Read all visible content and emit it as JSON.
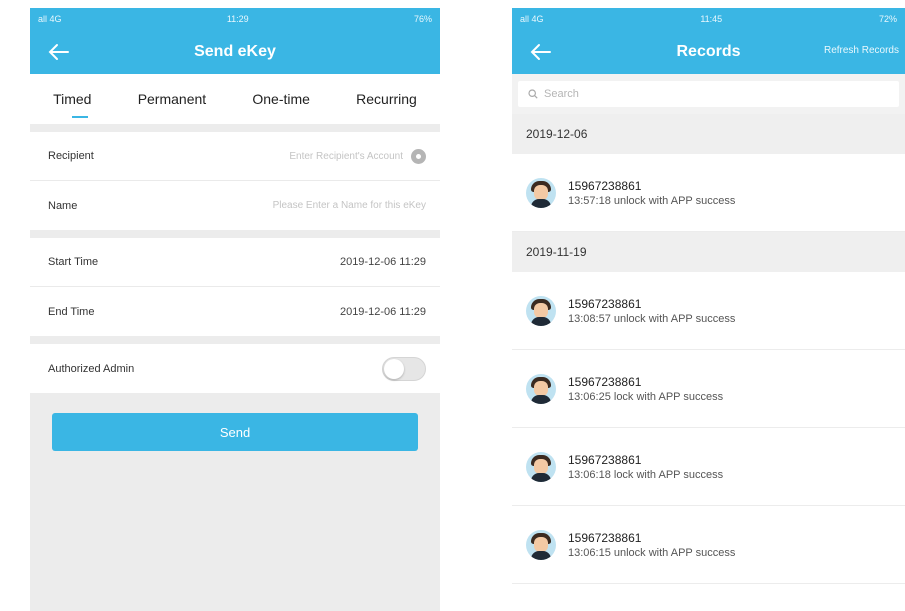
{
  "left": {
    "status": {
      "carrier": "all 4G",
      "time": "11:29",
      "battery": "76%"
    },
    "title": "Send eKey",
    "tabs": [
      "Timed",
      "Permanent",
      "One-time",
      "Recurring"
    ],
    "recipient": {
      "label": "Recipient",
      "placeholder": "Enter Recipient's Account"
    },
    "name": {
      "label": "Name",
      "placeholder": "Please Enter a Name for this eKey"
    },
    "start_time": {
      "label": "Start Time",
      "value": "2019-12-06 11:29"
    },
    "end_time": {
      "label": "End Time",
      "value": "2019-12-06 11:29"
    },
    "admin": {
      "label": "Authorized Admin"
    },
    "send_label": "Send"
  },
  "right": {
    "status": {
      "carrier": "all 4G",
      "time": "11:45",
      "battery": "72%"
    },
    "title": "Records",
    "refresh_label": "Refresh Records",
    "search_placeholder": "Search",
    "groups": [
      {
        "date": "2019-12-06",
        "records": [
          {
            "account": "15967238861",
            "event": "13:57:18 unlock with APP success"
          }
        ]
      },
      {
        "date": "2019-11-19",
        "records": [
          {
            "account": "15967238861",
            "event": "13:08:57 unlock with APP success"
          },
          {
            "account": "15967238861",
            "event": "13:06:25 lock with APP success"
          },
          {
            "account": "15967238861",
            "event": "13:06:18 lock with APP success"
          },
          {
            "account": "15967238861",
            "event": "13:06:15 unlock with APP success"
          }
        ]
      }
    ]
  }
}
